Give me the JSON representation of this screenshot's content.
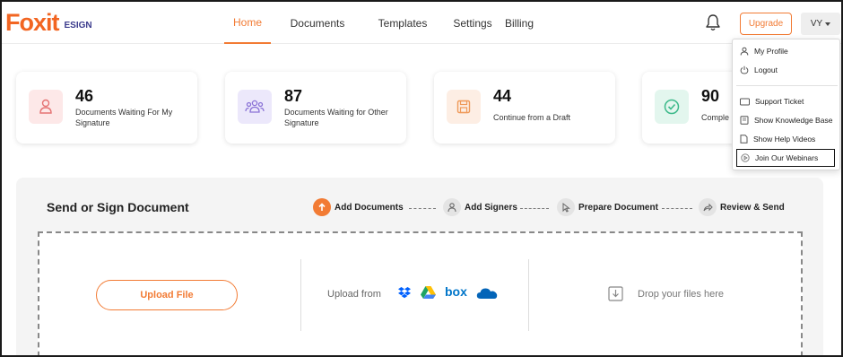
{
  "brand": {
    "name": "Foxit",
    "product": "ESIGN"
  },
  "nav": {
    "items": [
      {
        "label": "Home",
        "active": true
      },
      {
        "label": "Documents",
        "active": false
      },
      {
        "label": "Templates",
        "active": false
      },
      {
        "label": "Settings",
        "active": false
      },
      {
        "label": "Billing",
        "active": false
      }
    ]
  },
  "header": {
    "upgrade_label": "Upgrade",
    "user_initials": "VY",
    "bell_icon": "bell-icon"
  },
  "stats": [
    {
      "count": "46",
      "label": "Documents Waiting For My Signature",
      "icon": "person-icon",
      "color": "#fde8e8"
    },
    {
      "count": "87",
      "label": "Documents Waiting for Other Signature",
      "icon": "group-icon",
      "color": "#ece8fb"
    },
    {
      "count": "44",
      "label": "Continue from a Draft",
      "icon": "save-icon",
      "color": "#fdeee4"
    },
    {
      "count": "90",
      "label": "Comple",
      "icon": "check-circle-icon",
      "color": "#e3f6ee"
    }
  ],
  "send_panel": {
    "title": "Send or Sign Document",
    "steps": [
      {
        "label": "Add Documents",
        "icon": "upload-arrow-icon",
        "active": true
      },
      {
        "label": "Add Signers",
        "icon": "user-icon",
        "active": false
      },
      {
        "label": "Prepare Document",
        "icon": "cursor-icon",
        "active": false
      },
      {
        "label": "Review & Send",
        "icon": "share-icon",
        "active": false
      }
    ],
    "upload_file_label": "Upload File",
    "upload_from_label": "Upload from",
    "cloud_sources": [
      "dropbox-icon",
      "google-drive-icon",
      "box-icon",
      "onedrive-icon"
    ],
    "box_text": "box",
    "drop_label": "Drop your files here"
  },
  "user_menu": {
    "items": [
      {
        "label": "My Profile",
        "icon": "user-icon"
      },
      {
        "label": "Logout",
        "icon": "power-icon"
      },
      {
        "label": "Support Ticket",
        "icon": "ticket-icon"
      },
      {
        "label": "Show Knowledge Base",
        "icon": "book-icon"
      },
      {
        "label": "Show Help Videos",
        "icon": "document-icon"
      },
      {
        "label": "Join Our Webinars",
        "icon": "play-circle-icon"
      }
    ]
  },
  "colors": {
    "accent": "#f27b34",
    "dropbox": "#0061ff",
    "drive_green": "#1fa463",
    "box_blue": "#0075c9",
    "onedrive": "#0364b8"
  }
}
